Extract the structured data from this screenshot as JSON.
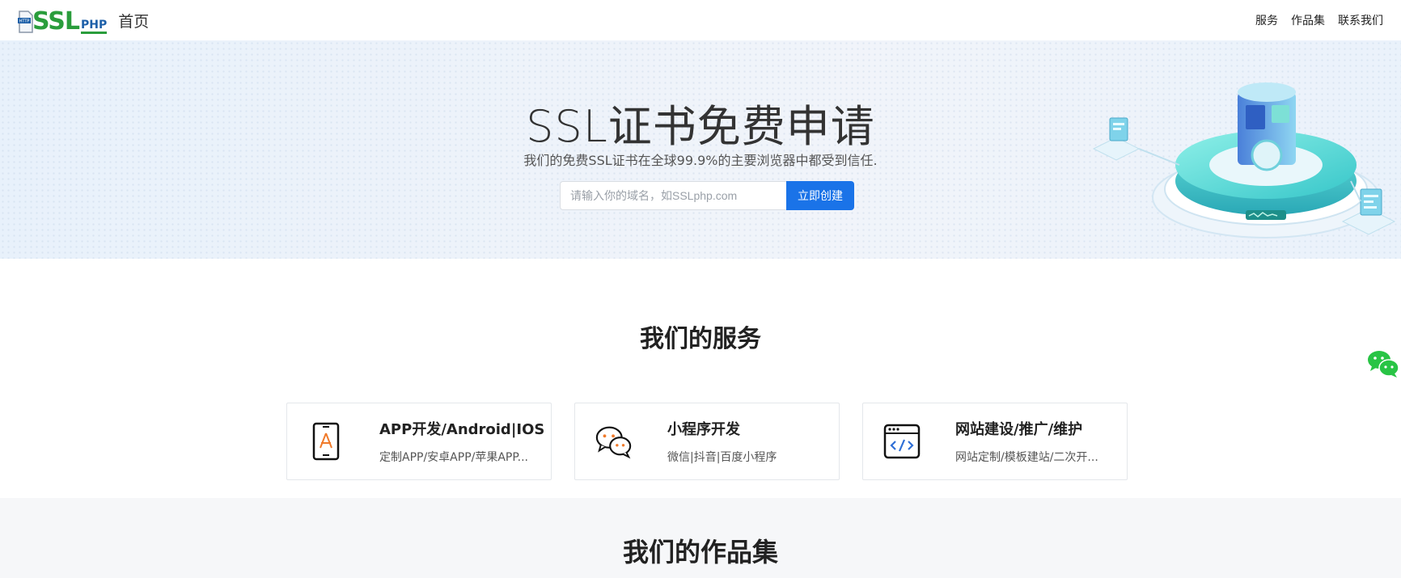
{
  "header": {
    "logo": {
      "main": "SSL",
      "sub": "PHP",
      "doc_tag": "HTTP"
    },
    "home_label": "首页",
    "nav": [
      "服务",
      "作品集",
      "联系我们"
    ]
  },
  "hero": {
    "title": "SSL证书免费申请",
    "subtitle": "我们的免费SSL证书在全球99.9%的主要浏览器中都受到信任.",
    "input_placeholder": "请输入你的域名，如SSLphp.com",
    "button_label": "立即创建"
  },
  "services": {
    "title": "我们的服务",
    "items": [
      {
        "title": "APP开发/Android|IOS",
        "desc": "定制APP/安卓APP/苹果APP...",
        "icon": "phone-app-icon"
      },
      {
        "title": "小程序开发",
        "desc": "微信|抖音|百度小程序",
        "icon": "chat-bubbles-icon"
      },
      {
        "title": "网站建设/推广/维护",
        "desc": "网站定制/模板建站/二次开...",
        "icon": "browser-code-icon"
      }
    ]
  },
  "portfolio": {
    "title": "我们的作品集"
  },
  "colors": {
    "brand_green": "#2a9d3c",
    "brand_blue": "#1c5fa8",
    "accent": "#1a73e8",
    "wechat": "#28c445"
  }
}
